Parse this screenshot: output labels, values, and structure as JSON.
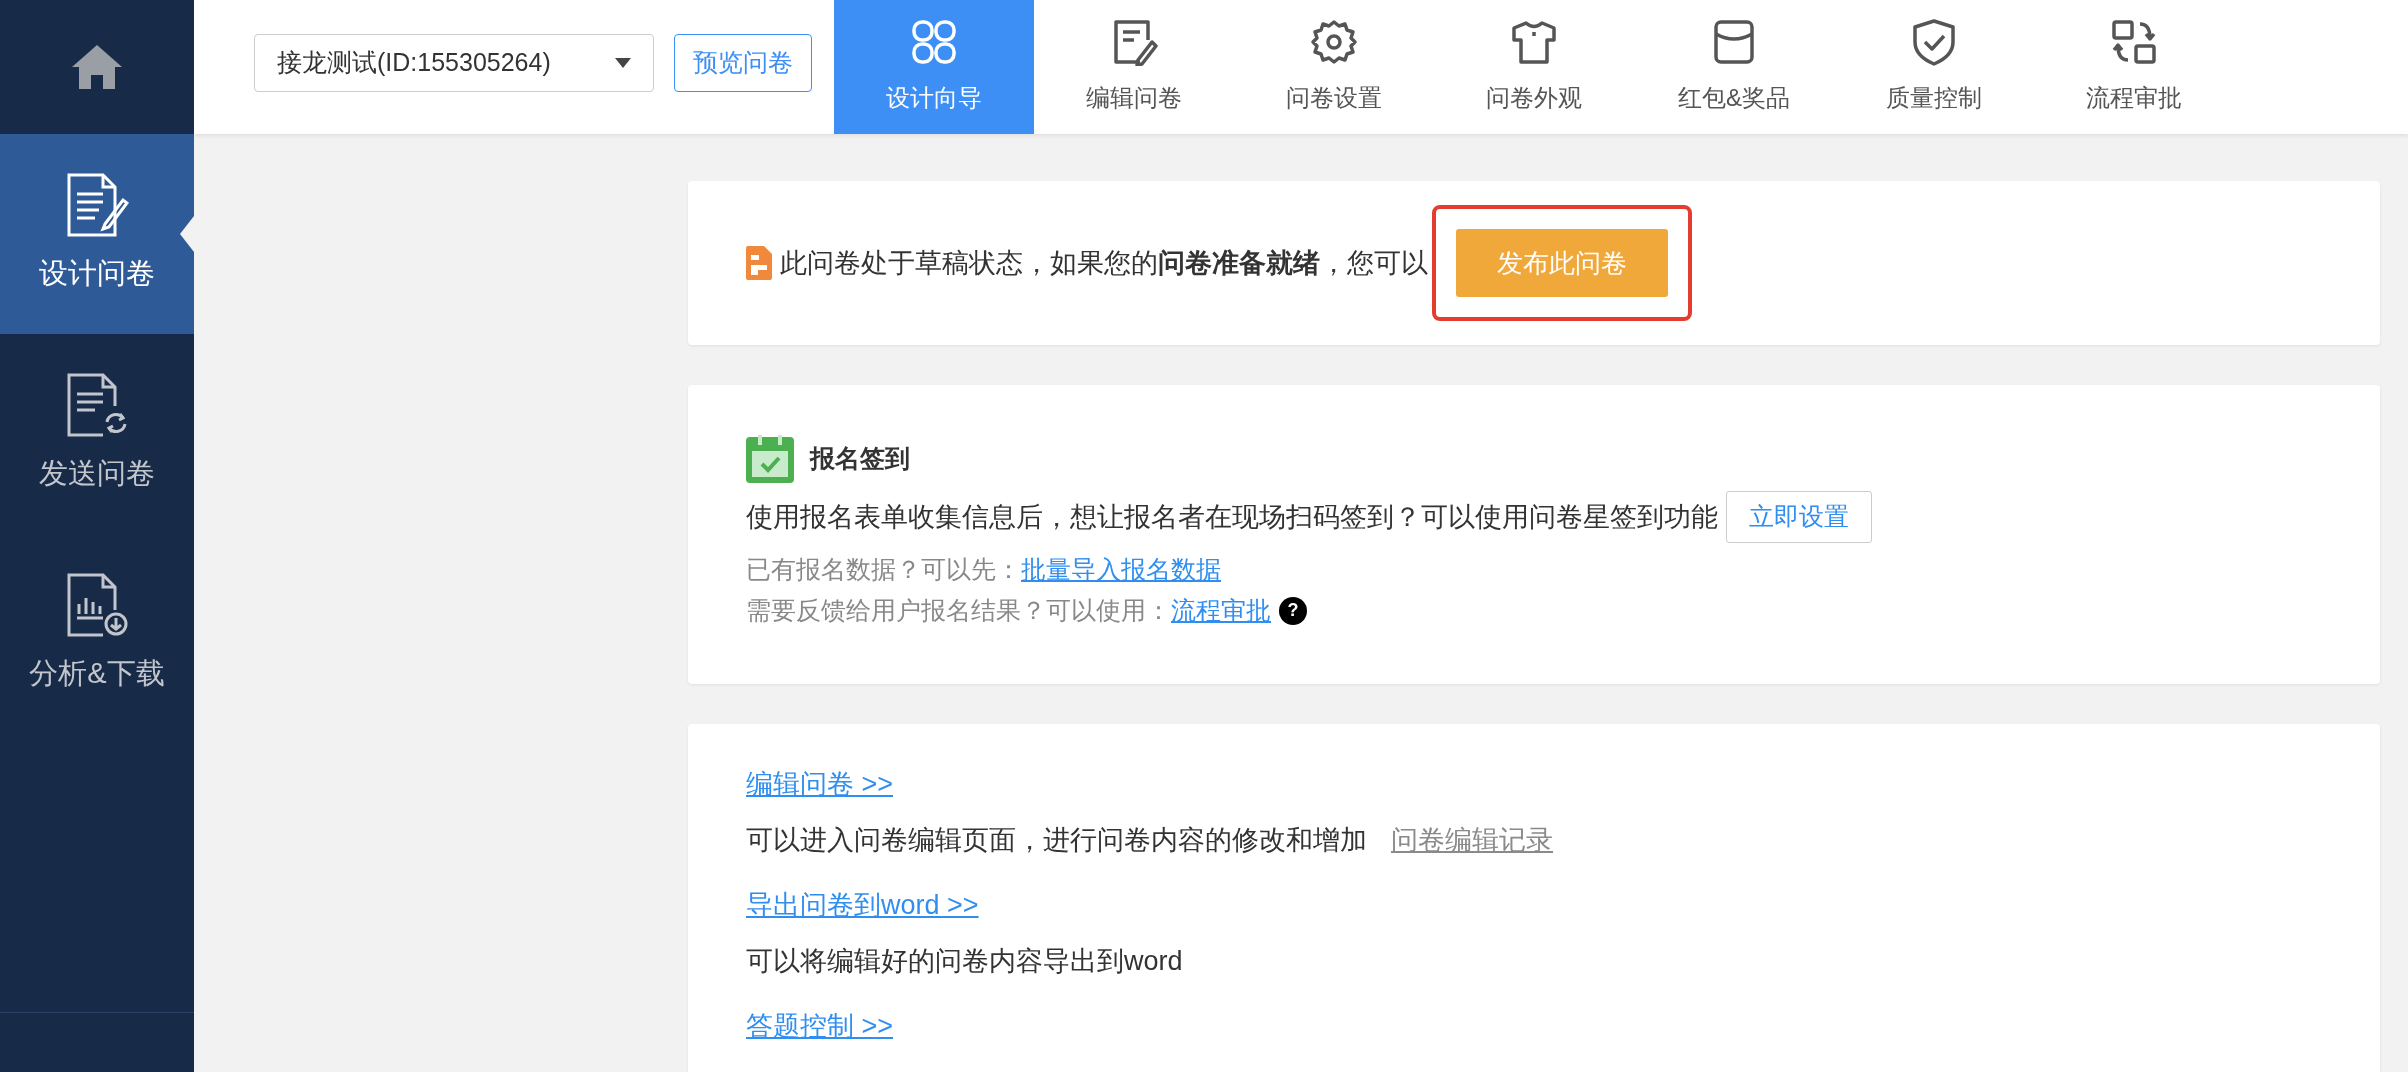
{
  "sidebar": {
    "items": [
      {
        "kind": "design",
        "label": "设计问卷",
        "selected": true
      },
      {
        "kind": "send",
        "label": "发送问卷",
        "selected": false
      },
      {
        "kind": "analyze",
        "label": "分析&下载",
        "selected": false
      }
    ]
  },
  "topbar": {
    "survey_select": {
      "value": "接龙测试(ID:155305264)"
    },
    "preview_button": "预览问卷",
    "tabs": [
      {
        "kind": "wizard",
        "label": "设计向导",
        "selected": true
      },
      {
        "kind": "edit",
        "label": "编辑问卷",
        "selected": false
      },
      {
        "kind": "settings",
        "label": "问卷设置",
        "selected": false
      },
      {
        "kind": "appearance",
        "label": "问卷外观",
        "selected": false
      },
      {
        "kind": "rewards",
        "label": "红包&奖品",
        "selected": false
      },
      {
        "kind": "quality",
        "label": "质量控制",
        "selected": false
      },
      {
        "kind": "approval",
        "label": "流程审批",
        "selected": false
      }
    ]
  },
  "status_card": {
    "message": "此问卷处于草稿状态，如果您的**问卷准备就绪**，您可以",
    "publish_button": "发布此问卷",
    "highlighted": true
  },
  "signin_card": {
    "title": "报名签到",
    "description": "使用报名表单收集信息后，想让报名者在现场扫码签到？可以使用问卷星签到功能",
    "setup_button": "立即设置",
    "hints": [
      {
        "text": "已有报名数据？可以先：",
        "link": "批量导入报名数据"
      },
      {
        "text": "需要反馈给用户报名结果？可以使用：",
        "link": "流程审批",
        "help": "?"
      }
    ]
  },
  "actions_card": {
    "items": [
      {
        "link": "编辑问卷 >>",
        "description": "可以进入问卷编辑页面，进行问卷内容的修改和增加",
        "extra_link": "问卷编辑记录"
      },
      {
        "link": "导出问卷到word >>",
        "description": "可以将编辑好的问卷内容导出到word"
      },
      {
        "link": "答题控制 >>"
      }
    ]
  }
}
